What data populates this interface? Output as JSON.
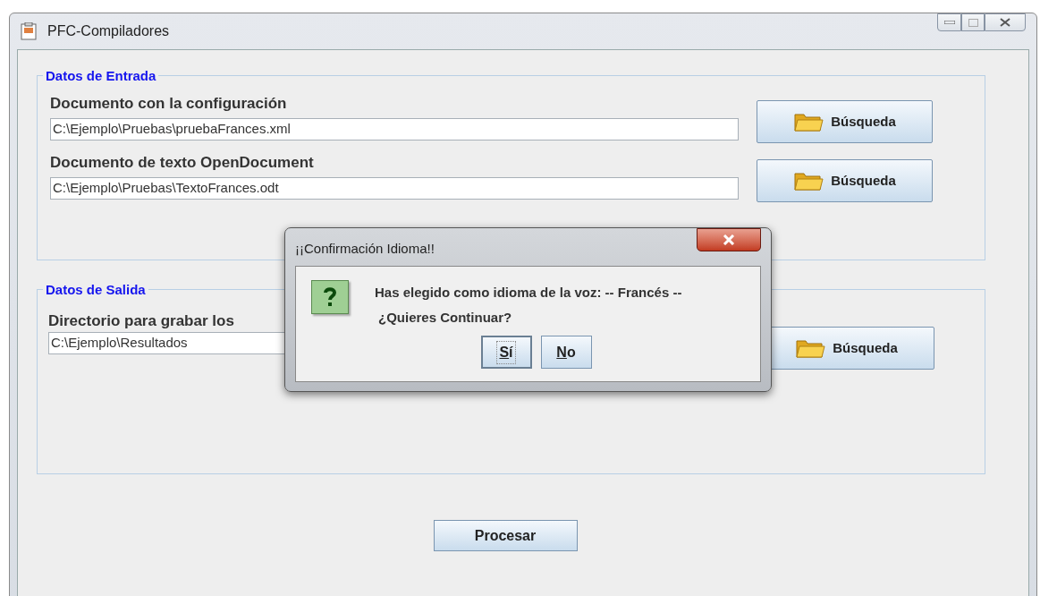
{
  "window": {
    "title": "PFC-Compiladores"
  },
  "groups": [
    {
      "title": "Datos de Entrada",
      "fields": [
        {
          "label": "Documento con la configuración",
          "value": "C:\\Ejemplo\\Pruebas\\pruebaFrances.xml",
          "button": "Búsqueda"
        },
        {
          "label": "Documento de texto OpenDocument",
          "value": "C:\\Ejemplo\\Pruebas\\TextoFrances.odt",
          "button": "Búsqueda"
        }
      ]
    },
    {
      "title": "Datos de Salida",
      "fields": [
        {
          "label": "Directorio para grabar los",
          "value": "C:\\Ejemplo\\Resultados",
          "button": "Búsqueda"
        }
      ]
    }
  ],
  "process_button": "Procesar",
  "dialog": {
    "title": "¡¡Confirmación Idioma!!",
    "message": "Has elegido como idioma de la voz: -- Francés --",
    "question": "¿Quieres Continuar?",
    "buttons": [
      {
        "label": "Sí",
        "selected": true
      },
      {
        "label": "No",
        "selected": false
      }
    ]
  }
}
